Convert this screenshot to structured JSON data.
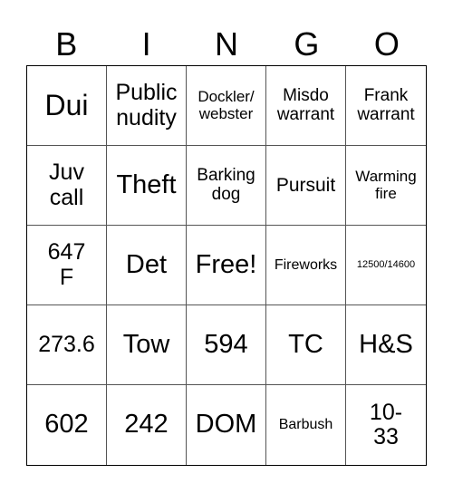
{
  "header": {
    "letters": [
      "B",
      "I",
      "N",
      "G",
      "O"
    ]
  },
  "board": {
    "rows": [
      [
        "Dui",
        "Public\nnudity",
        "Dockler/\nwebster",
        "Misdo\nwarrant",
        "Frank\nwarrant"
      ],
      [
        "Juv\ncall",
        "Theft",
        "Barking\ndog",
        "Pursuit",
        "Warming\nfire"
      ],
      [
        "647\nF",
        "Det",
        "Free!",
        "Fireworks",
        "12500/14600"
      ],
      [
        "273.6",
        "Tow",
        "594",
        "TC",
        "H&S"
      ],
      [
        "602",
        "242",
        "DOM",
        "Barbush",
        "10-\n33"
      ]
    ],
    "free_space": "Free!",
    "colors": {
      "background": "#ffffff",
      "text": "#000000",
      "grid_line": "#555555"
    }
  }
}
